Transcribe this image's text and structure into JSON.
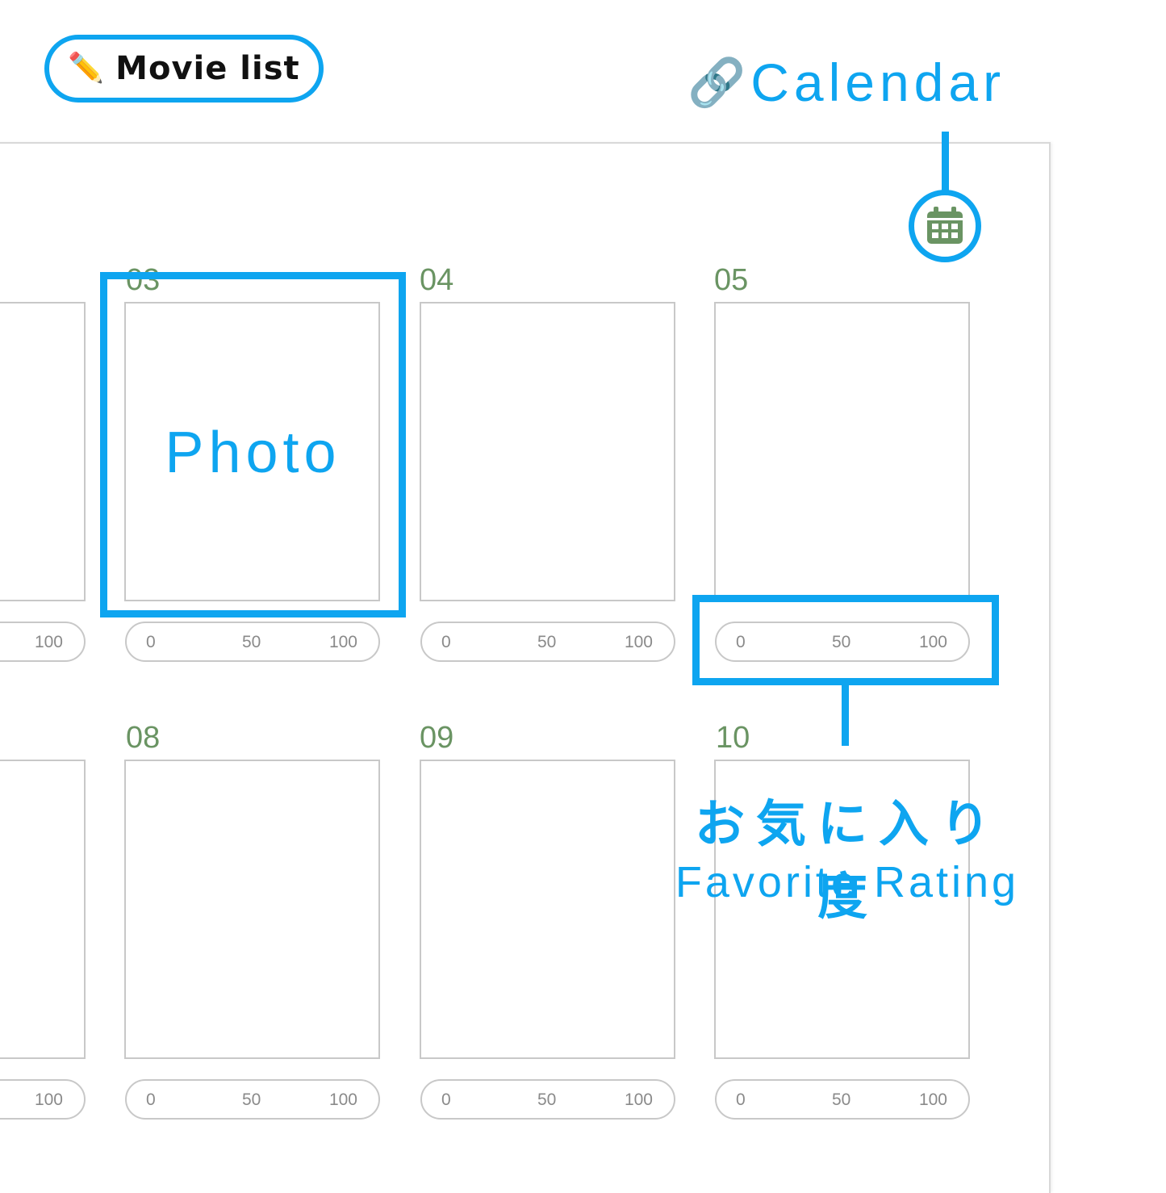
{
  "header": {
    "movie_list_label": "Movie list",
    "calendar_label": "Calendar"
  },
  "annotations": {
    "photo": "Photo",
    "favorite_rating_jp": "お気に入り度",
    "favorite_rating_en": "Favorite Rating"
  },
  "days_row1": [
    "03",
    "04",
    "05"
  ],
  "days_row2": [
    "08",
    "09",
    "10"
  ],
  "rating_scale": {
    "min": "0",
    "mid": "50",
    "max": "100"
  },
  "colors": {
    "accent": "#0ea5f0",
    "day_number": "#6a9463",
    "calendar_icon": "#6a9463"
  },
  "icons": {
    "pencil": "pencil-icon",
    "link": "link-icon",
    "calendar": "calendar-icon"
  }
}
